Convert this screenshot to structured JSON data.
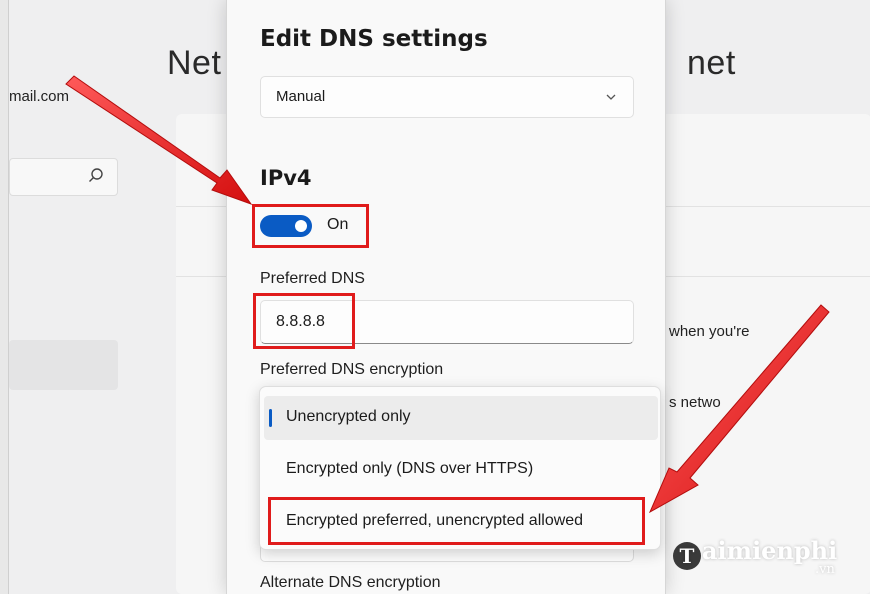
{
  "background": {
    "title_left": "Net",
    "title_right": "net",
    "email": "mail.com",
    "text_when": "when you're",
    "text_network": "s netwo"
  },
  "dialog": {
    "title": "Edit DNS settings",
    "mode_select": {
      "value": "Manual"
    },
    "ipv4": {
      "heading": "IPv4",
      "toggle_label": "On",
      "toggle_on": true,
      "preferred_dns_label": "Preferred DNS",
      "preferred_dns_value": "8.8.8.8",
      "encryption_label": "Preferred DNS encryption",
      "encryption_options": [
        "Unencrypted only",
        "Encrypted only (DNS over HTTPS)",
        "Encrypted preferred, unencrypted allowed"
      ],
      "encryption_selected": "Unencrypted only",
      "alternate_encryption_label": "Alternate DNS encryption"
    }
  },
  "watermark": {
    "brand": "aimienphi",
    "initial": "T",
    "tld": ".vn"
  },
  "colors": {
    "accent": "#0a5bc4",
    "annotation": "#e01b1b"
  }
}
